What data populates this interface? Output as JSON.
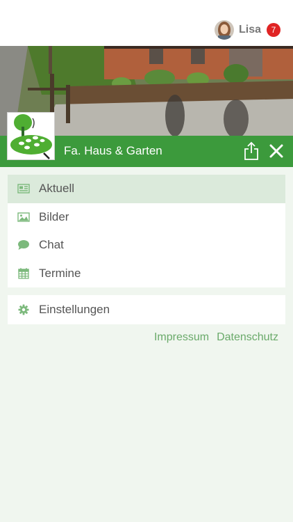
{
  "colors": {
    "brand_green": "#3c9a3c",
    "icon_green": "#7cb97c",
    "link_green": "#6aaa6a",
    "badge_red": "#e02424"
  },
  "header": {
    "user_name": "Lisa",
    "notification_count": "7"
  },
  "group": {
    "title": "Fa. Haus & Garten"
  },
  "menu": {
    "items": [
      {
        "label": "Aktuell",
        "icon": "newspaper-icon"
      },
      {
        "label": "Bilder",
        "icon": "image-icon"
      },
      {
        "label": "Chat",
        "icon": "chat-bubble-icon"
      },
      {
        "label": "Termine",
        "icon": "calendar-icon"
      }
    ],
    "settings": {
      "label": "Einstellungen",
      "icon": "gear-icon"
    }
  },
  "footer": {
    "impressum": "Impressum",
    "datenschutz": "Datenschutz"
  }
}
